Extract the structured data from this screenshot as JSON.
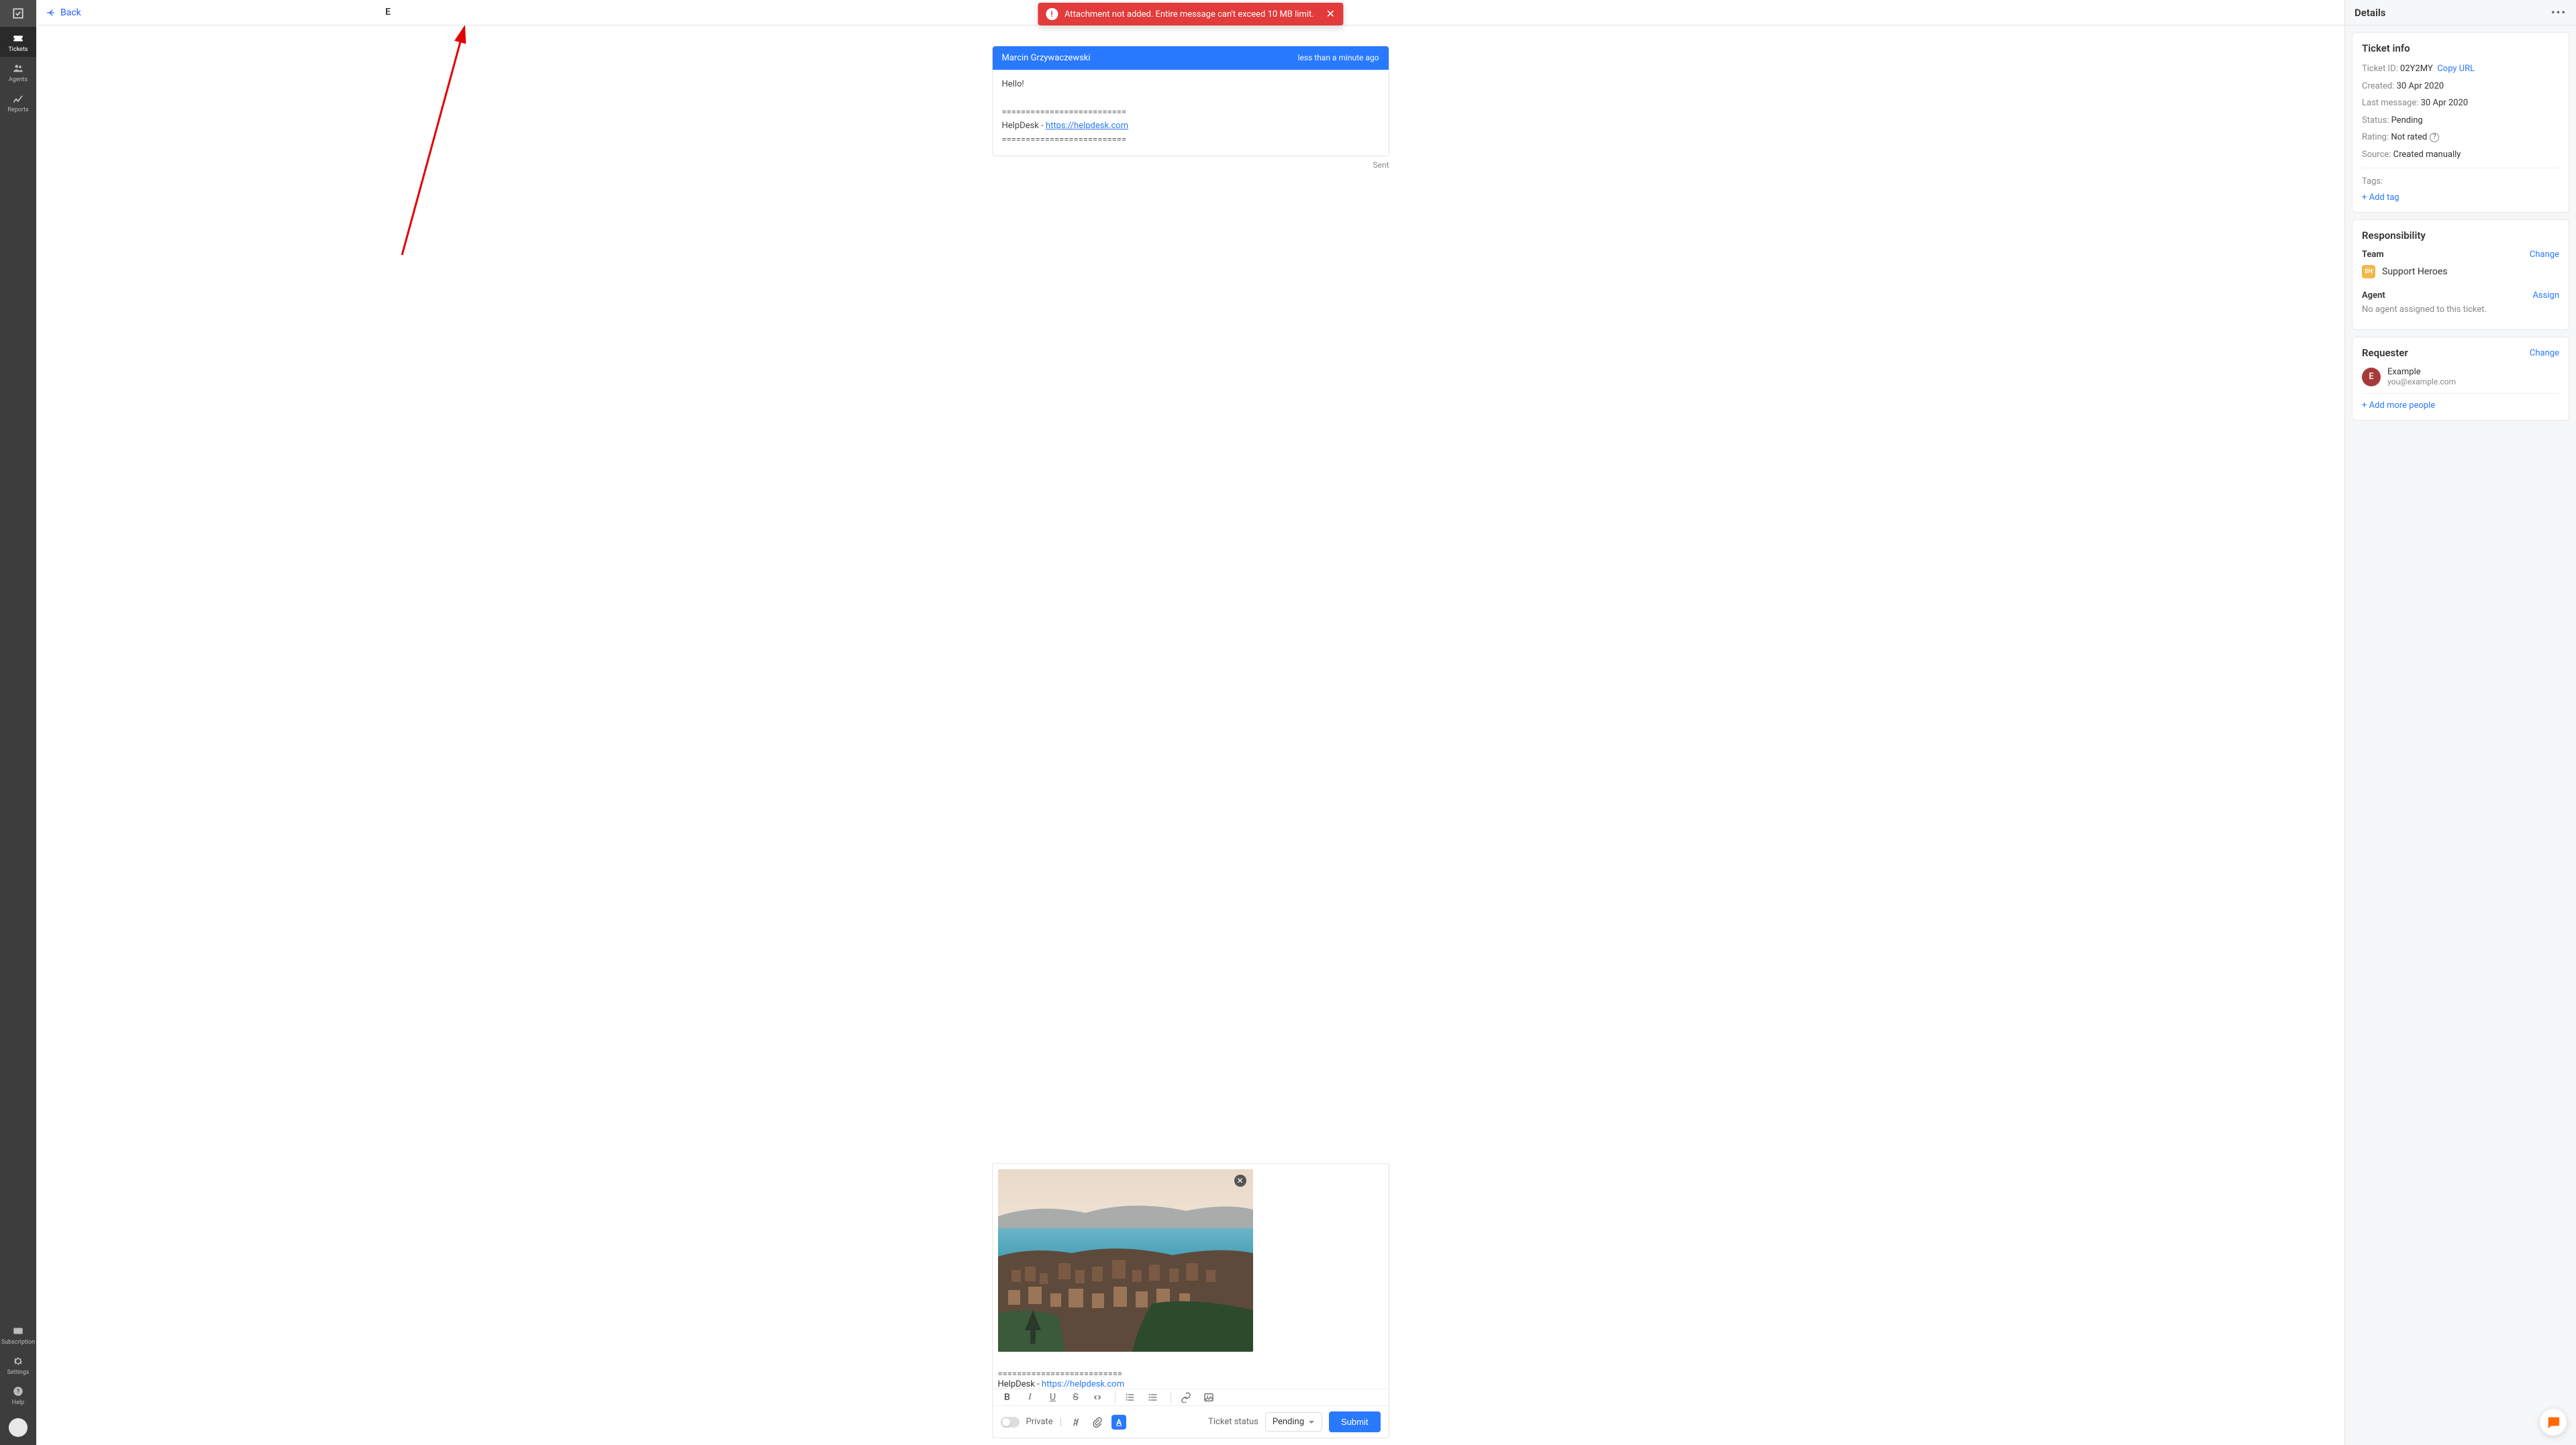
{
  "sidebar": {
    "items": [
      {
        "label": "Tickets"
      },
      {
        "label": "Agents"
      },
      {
        "label": "Reports"
      }
    ],
    "bottom_items": [
      {
        "label": "Subscription"
      },
      {
        "label": "Settings"
      },
      {
        "label": "Help"
      }
    ]
  },
  "topbar": {
    "back": "Back",
    "subject_initial": "E"
  },
  "toast": {
    "message": "Attachment not added. Entire message can't exceed 10 MB limit."
  },
  "message": {
    "author": "Marcin Grzywaczewski",
    "time": "less than a minute ago",
    "greeting": "Hello!",
    "separator": "==========================",
    "sig_prefix": "HelpDesk - ",
    "sig_link": "https://helpdesk.com",
    "status": "Sent"
  },
  "composer": {
    "sig_separator": "==========================",
    "sig_prefix": "HelpDesk",
    "sig_dash": " - ",
    "sig_link": "https://helpdesk.com",
    "private_label": "Private",
    "ticket_status_label": "Ticket status",
    "status_value": "Pending",
    "submit_label": "Submit"
  },
  "details": {
    "title": "Details",
    "ticket_info": {
      "heading": "Ticket info",
      "id_label": "Ticket ID:",
      "id_value": "02Y2MY",
      "copy_url": "Copy URL",
      "created_label": "Created:",
      "created_value": "30 Apr 2020",
      "lastmsg_label": "Last message:",
      "lastmsg_value": "30 Apr 2020",
      "status_label": "Status:",
      "status_value": "Pending",
      "rating_label": "Rating:",
      "rating_value": "Not rated",
      "source_label": "Source:",
      "source_value": "Created manually",
      "tags_label": "Tags:",
      "add_tag": "+ Add tag"
    },
    "responsibility": {
      "heading": "Responsibility",
      "team_label": "Team",
      "team_change": "Change",
      "team_name": "Support Heroes",
      "team_badge": "SH",
      "agent_label": "Agent",
      "agent_assign": "Assign",
      "no_agent": "No agent assigned to this ticket."
    },
    "requester": {
      "heading": "Requester",
      "change": "Change",
      "initial": "E",
      "name": "Example",
      "email": "you@example.com",
      "add_more": "+ Add more people"
    }
  }
}
